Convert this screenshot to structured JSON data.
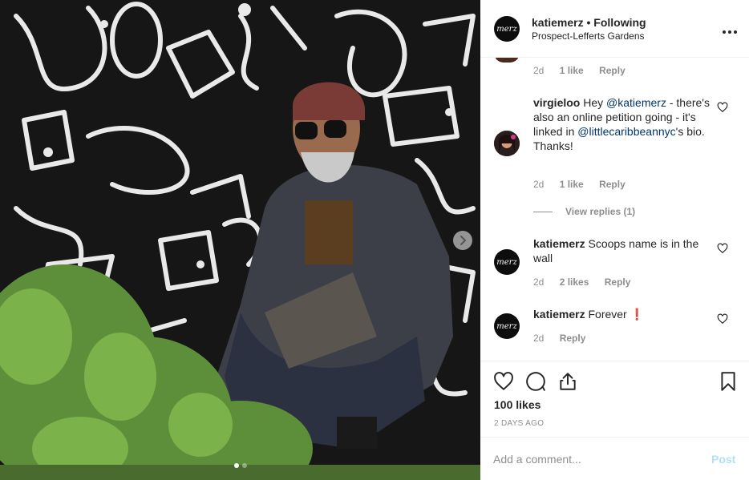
{
  "post": {
    "username": "katiemerz",
    "separator": "•",
    "follow_status": "Following",
    "location": "Prospect-Lefferts Gardens",
    "avatar_text": "merz",
    "more_icon": "more-options-icon"
  },
  "photo": {
    "next_icon": "chevron-right-icon",
    "carousel_count": 2,
    "carousel_active": 0
  },
  "comments": [
    {
      "id": "c0",
      "partial": true,
      "time": "2d",
      "likes": "1 like",
      "reply": "Reply"
    },
    {
      "id": "c1",
      "username": "virgieloo",
      "parts": [
        "Hey ",
        "@katiemerz",
        " - there's also an online petition going - it's linked in ",
        "@littlecaribbeannyc",
        "'s bio. Thanks!"
      ],
      "time": "2d",
      "likes": "1 like",
      "reply": "Reply",
      "view_replies": "View replies (1)"
    },
    {
      "id": "c2",
      "username": "katiemerz",
      "text": "Scoops name is in the wall",
      "avatar_text": "merz",
      "time": "2d",
      "likes": "2 likes",
      "reply": "Reply"
    },
    {
      "id": "c3",
      "username": "katiemerz",
      "text": "Forever",
      "emoji": "❗",
      "avatar_text": "merz",
      "time": "2d",
      "reply": "Reply"
    }
  ],
  "actions": {
    "like_icon": "heart-icon",
    "comment_icon": "comment-icon",
    "share_icon": "share-icon",
    "save_icon": "bookmark-icon",
    "likes": "100 likes",
    "date": "2 DAYS AGO"
  },
  "add_comment": {
    "placeholder": "Add a comment...",
    "post_label": "Post"
  },
  "colors": {
    "link": "#003569",
    "muted": "#8e8e8e",
    "post_disabled": "#b2dffc",
    "emoji_red": "#e0191e"
  }
}
